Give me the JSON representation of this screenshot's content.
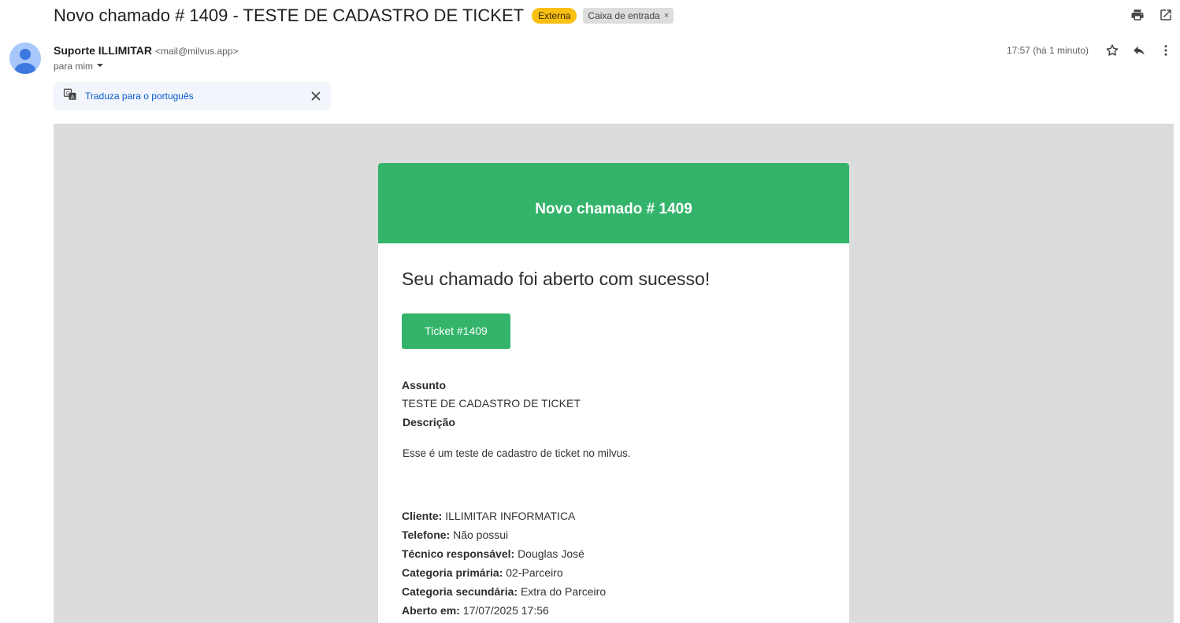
{
  "header": {
    "subject": "Novo chamado # 1409 - TESTE DE CADASTRO DE TICKET",
    "badge_external": "Externa",
    "label_inbox": "Caixa de entrada",
    "label_remove": "×"
  },
  "sender": {
    "name": "Suporte ILLIMITAR",
    "email": "<mail@milvus.app>",
    "to": "para mim",
    "timestamp": "17:57 (há 1 minuto)"
  },
  "translate": {
    "link": "Traduza para o português"
  },
  "email": {
    "banner_title": "Novo chamado # 1409",
    "success_title": "Seu chamado foi aberto com sucesso!",
    "ticket_button": "Ticket #1409",
    "assunto_label": "Assunto",
    "assunto_value": "TESTE DE CADASTRO DE TICKET",
    "descricao_label": "Descrição",
    "descricao_value": "Esse é um teste de cadastro de ticket no milvus.",
    "details": [
      {
        "label": "Cliente:",
        "value": "ILLIMITAR INFORMATICA"
      },
      {
        "label": "Telefone:",
        "value": "Não possui"
      },
      {
        "label": "Técnico responsável:",
        "value": "Douglas José"
      },
      {
        "label": "Categoria primária:",
        "value": "02-Parceiro"
      },
      {
        "label": "Categoria secundária:",
        "value": "Extra do Parceiro"
      },
      {
        "label": "Aberto em:",
        "value": "17/07/2025 17:56"
      }
    ]
  },
  "colors": {
    "brand_green": "#33b46a",
    "badge_yellow": "#f9bf12",
    "body_gray": "#dcdcdc",
    "link_blue": "#0b57d0"
  },
  "icons": [
    "print-icon",
    "open-in-new-icon",
    "avatar-icon",
    "dropdown-arrow-icon",
    "translate-icon",
    "close-icon",
    "star-icon",
    "reply-icon",
    "more-vert-icon"
  ]
}
